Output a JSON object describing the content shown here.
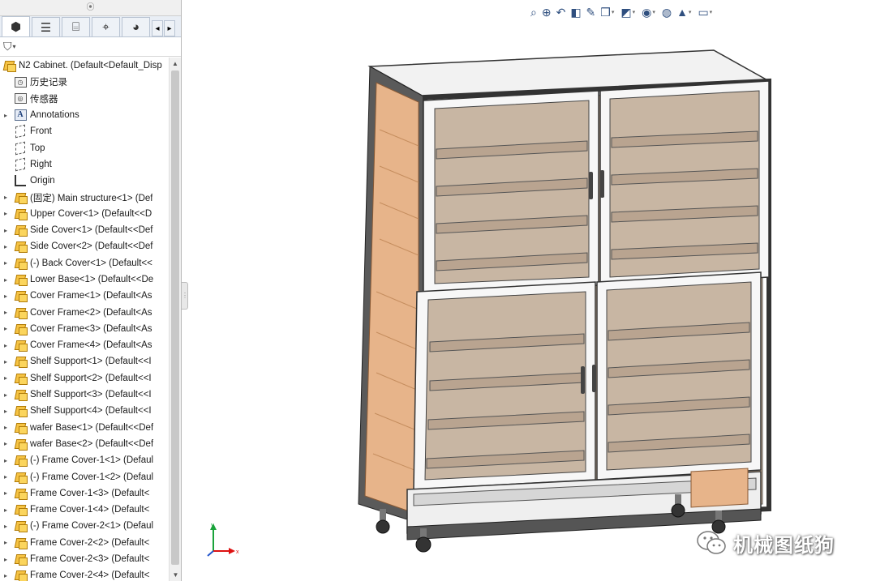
{
  "panel": {
    "tabs": [
      {
        "name": "feature-manager-tab-icon",
        "glyph": "⬢"
      },
      {
        "name": "property-manager-tab-icon",
        "glyph": "☰"
      },
      {
        "name": "configuration-manager-tab-icon",
        "glyph": "⌸"
      },
      {
        "name": "dimxpert-tab-icon",
        "glyph": "⌖"
      },
      {
        "name": "display-manager-tab-icon",
        "glyph": "◕"
      }
    ],
    "filter_icon": "filter-icon",
    "tree": [
      {
        "type": "root",
        "label": "N2 Cabinet.  (Default<Default_Disp",
        "icon": "assembly-icon",
        "expand": ""
      },
      {
        "type": "box",
        "label": "历史记录",
        "icon": "history-icon",
        "expand": "",
        "glyph": "◷"
      },
      {
        "type": "box",
        "label": "传感器",
        "icon": "sensor-icon",
        "expand": "",
        "glyph": "◎"
      },
      {
        "type": "ann",
        "label": "Annotations",
        "icon": "annotations-icon",
        "expand": "▸",
        "glyph": "A"
      },
      {
        "type": "plane",
        "label": "Front",
        "icon": "plane-icon",
        "expand": ""
      },
      {
        "type": "plane",
        "label": "Top",
        "icon": "plane-icon",
        "expand": ""
      },
      {
        "type": "plane",
        "label": "Right",
        "icon": "plane-icon",
        "expand": ""
      },
      {
        "type": "origin",
        "label": "Origin",
        "icon": "origin-icon",
        "expand": ""
      },
      {
        "type": "part",
        "label": "(固定) Main structure<1> (Def",
        "icon": "part-icon",
        "expand": "▸"
      },
      {
        "type": "part",
        "label": "Upper Cover<1> (Default<<D",
        "icon": "part-icon",
        "expand": "▸"
      },
      {
        "type": "part",
        "label": "Side Cover<1> (Default<<Def",
        "icon": "part-icon",
        "expand": "▸"
      },
      {
        "type": "part",
        "label": "Side Cover<2> (Default<<Def",
        "icon": "part-icon",
        "expand": "▸"
      },
      {
        "type": "part",
        "label": "(-) Back Cover<1> (Default<<",
        "icon": "part-icon",
        "expand": "▸"
      },
      {
        "type": "part",
        "label": "Lower Base<1> (Default<<De",
        "icon": "part-icon",
        "expand": "▸"
      },
      {
        "type": "part",
        "label": "Cover Frame<1> (Default<As",
        "icon": "part-icon",
        "expand": "▸"
      },
      {
        "type": "part",
        "label": "Cover Frame<2> (Default<As",
        "icon": "part-icon",
        "expand": "▸"
      },
      {
        "type": "part",
        "label": "Cover Frame<3> (Default<As",
        "icon": "part-icon",
        "expand": "▸"
      },
      {
        "type": "part",
        "label": "Cover Frame<4> (Default<As",
        "icon": "part-icon",
        "expand": "▸"
      },
      {
        "type": "part",
        "label": "Shelf Support<1> (Default<<I",
        "icon": "part-icon",
        "expand": "▸"
      },
      {
        "type": "part",
        "label": "Shelf Support<2> (Default<<I",
        "icon": "part-icon",
        "expand": "▸"
      },
      {
        "type": "part",
        "label": "Shelf Support<3> (Default<<I",
        "icon": "part-icon",
        "expand": "▸"
      },
      {
        "type": "part",
        "label": "Shelf Support<4> (Default<<I",
        "icon": "part-icon",
        "expand": "▸"
      },
      {
        "type": "part",
        "label": "wafer Base<1> (Default<<Def",
        "icon": "part-icon",
        "expand": "▸"
      },
      {
        "type": "part",
        "label": "wafer Base<2> (Default<<Def",
        "icon": "part-icon",
        "expand": "▸"
      },
      {
        "type": "part",
        "label": "(-) Frame Cover-1<1> (Defaul",
        "icon": "part-icon",
        "expand": "▸"
      },
      {
        "type": "part",
        "label": "(-) Frame Cover-1<2> (Defaul",
        "icon": "part-icon",
        "expand": "▸"
      },
      {
        "type": "part",
        "label": "Frame Cover-1<3> (Default<",
        "icon": "part-icon",
        "expand": "▸"
      },
      {
        "type": "part",
        "label": "Frame Cover-1<4> (Default<",
        "icon": "part-icon",
        "expand": "▸"
      },
      {
        "type": "part",
        "label": "(-) Frame Cover-2<1> (Defaul",
        "icon": "part-icon",
        "expand": "▸"
      },
      {
        "type": "part",
        "label": "Frame Cover-2<2> (Default<",
        "icon": "part-icon",
        "expand": "▸"
      },
      {
        "type": "part",
        "label": "Frame Cover-2<3> (Default<",
        "icon": "part-icon",
        "expand": "▸"
      },
      {
        "type": "part",
        "label": "Frame Cover-2<4> (Default<",
        "icon": "part-icon",
        "expand": "▸"
      }
    ]
  },
  "hud": {
    "buttons": [
      {
        "name": "zoom-to-fit-icon",
        "glyph": "⌕",
        "caret": false
      },
      {
        "name": "zoom-to-area-icon",
        "glyph": "⊕",
        "caret": false
      },
      {
        "name": "previous-view-icon",
        "glyph": "↶",
        "caret": false
      },
      {
        "name": "section-view-icon",
        "glyph": "◧",
        "caret": false
      },
      {
        "name": "dynamic-annotation-icon",
        "glyph": "✎",
        "caret": false
      },
      {
        "name": "view-orientation-icon",
        "glyph": "❒",
        "caret": true
      },
      {
        "name": "display-style-icon",
        "glyph": "◩",
        "caret": true
      },
      {
        "name": "hide-show-items-icon",
        "glyph": "◉",
        "caret": true
      },
      {
        "name": "edit-appearance-icon",
        "glyph": "◍",
        "caret": false
      },
      {
        "name": "apply-scene-icon",
        "glyph": "▲",
        "caret": true
      },
      {
        "name": "view-settings-icon",
        "glyph": "▭",
        "caret": true
      }
    ]
  },
  "triad": {
    "x": "x",
    "y": "y"
  },
  "watermark": {
    "text": "机械图纸狗",
    "icon": "wechat-icon"
  },
  "colors": {
    "panel_bg": "#ffffff",
    "tab_bg": "#e9eef5",
    "part_icon": "#f6c343",
    "frame": "#4a4a4a",
    "shelf": "#c9b29a",
    "panel_wood": "#e7b48a"
  }
}
